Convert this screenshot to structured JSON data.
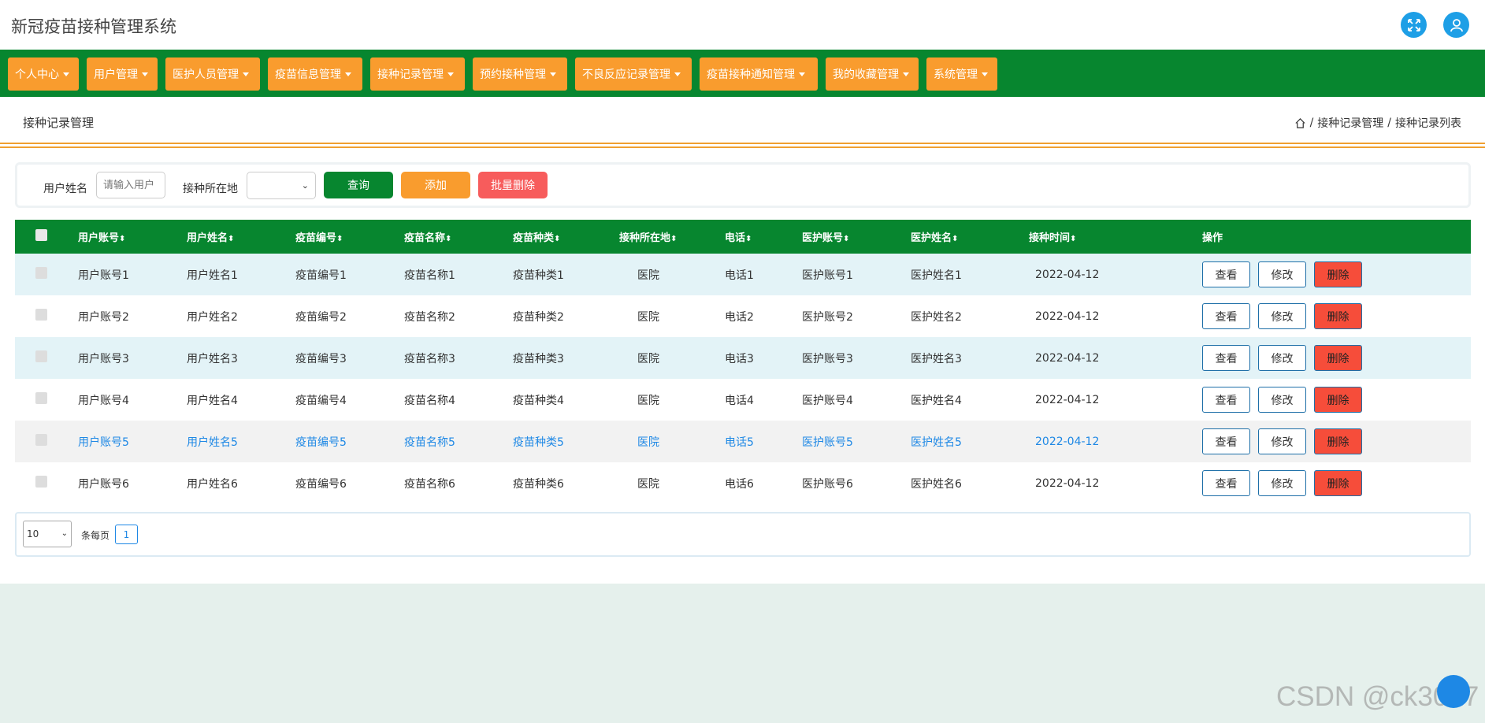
{
  "app": {
    "title": "新冠疫苗接种管理系统",
    "watermark": "CSDN @ck3017",
    "accent": "#07862f",
    "nav_color": "#f99c2e",
    "danger": "#f64d3a"
  },
  "nav": {
    "items": [
      {
        "label": "个人中心"
      },
      {
        "label": "用户管理"
      },
      {
        "label": "医护人员管理"
      },
      {
        "label": "疫苗信息管理"
      },
      {
        "label": "接种记录管理"
      },
      {
        "label": "预约接种管理"
      },
      {
        "label": "不良反应记录管理"
      },
      {
        "label": "疫苗接种通知管理"
      },
      {
        "label": "我的收藏管理"
      },
      {
        "label": "系统管理"
      }
    ]
  },
  "page": {
    "title": "接种记录管理",
    "breadcrumb": [
      "接种记录管理",
      "接种记录列表"
    ],
    "breadcrumb_sep": "/"
  },
  "search": {
    "name_label": "用户姓名",
    "name_placeholder": "请输入用户",
    "location_label": "接种所在地",
    "query_btn": "查询",
    "add_btn": "添加",
    "batch_delete_btn": "批量删除"
  },
  "table": {
    "headers": [
      "用户账号",
      "用户姓名",
      "疫苗编号",
      "疫苗名称",
      "疫苗种类",
      "接种所在地",
      "电话",
      "医护账号",
      "医护姓名",
      "接种时间"
    ],
    "action_header": "操作",
    "actions": {
      "view": "查看",
      "edit": "修改",
      "delete": "删除"
    },
    "rows": [
      [
        "用户账号1",
        "用户姓名1",
        "疫苗编号1",
        "疫苗名称1",
        "疫苗种类1",
        "医院",
        "电话1",
        "医护账号1",
        "医护姓名1",
        "2022-04-12"
      ],
      [
        "用户账号2",
        "用户姓名2",
        "疫苗编号2",
        "疫苗名称2",
        "疫苗种类2",
        "医院",
        "电话2",
        "医护账号2",
        "医护姓名2",
        "2022-04-12"
      ],
      [
        "用户账号3",
        "用户姓名3",
        "疫苗编号3",
        "疫苗名称3",
        "疫苗种类3",
        "医院",
        "电话3",
        "医护账号3",
        "医护姓名3",
        "2022-04-12"
      ],
      [
        "用户账号4",
        "用户姓名4",
        "疫苗编号4",
        "疫苗名称4",
        "疫苗种类4",
        "医院",
        "电话4",
        "医护账号4",
        "医护姓名4",
        "2022-04-12"
      ],
      [
        "用户账号5",
        "用户姓名5",
        "疫苗编号5",
        "疫苗名称5",
        "疫苗种类5",
        "医院",
        "电话5",
        "医护账号5",
        "医护姓名5",
        "2022-04-12"
      ],
      [
        "用户账号6",
        "用户姓名6",
        "疫苗编号6",
        "疫苗名称6",
        "疫苗种类6",
        "医院",
        "电话6",
        "医护账号6",
        "医护姓名6",
        "2022-04-12"
      ]
    ]
  },
  "pager": {
    "page_size": "10",
    "per_page_label": "条每页",
    "current_page": "1"
  }
}
